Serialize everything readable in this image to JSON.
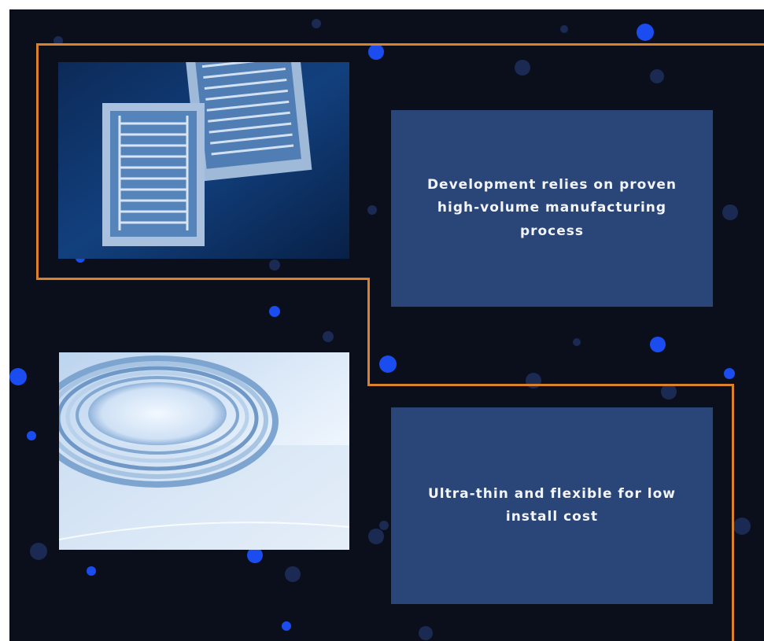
{
  "colors": {
    "background": "#0a0f1b",
    "connector": "#d9822b",
    "card": "#2a4678",
    "card_text": "#f2f4f8",
    "dot_bright": "#1a4cf0",
    "dot_muted": "#1b2a52"
  },
  "features": [
    {
      "text": "Development relies on proven high-volume manufacturing process",
      "image_icon": "printed-circuit-sheets-photo"
    },
    {
      "text": "Ultra-thin and flexible for low install cost",
      "image_icon": "transparent-film-roll-photo"
    }
  ]
}
